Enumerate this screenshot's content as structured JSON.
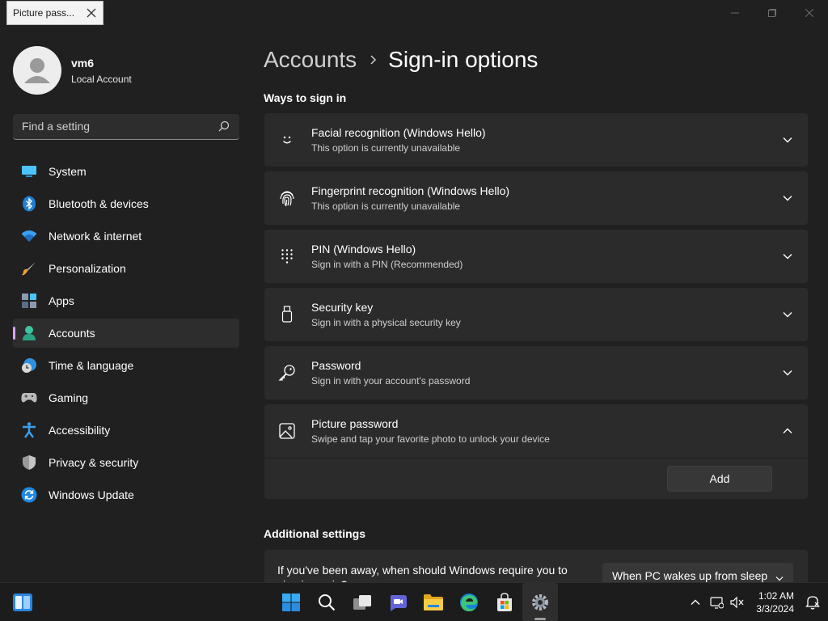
{
  "tooltip": {
    "label": "Picture pass..."
  },
  "profile": {
    "name": "vm6",
    "account_type": "Local Account"
  },
  "search": {
    "placeholder": "Find a setting"
  },
  "sidebar": {
    "items": [
      {
        "label": "System",
        "icon": "system-icon"
      },
      {
        "label": "Bluetooth & devices",
        "icon": "bluetooth-icon"
      },
      {
        "label": "Network & internet",
        "icon": "wifi-icon"
      },
      {
        "label": "Personalization",
        "icon": "brush-icon"
      },
      {
        "label": "Apps",
        "icon": "apps-icon"
      },
      {
        "label": "Accounts",
        "icon": "accounts-icon",
        "active": true
      },
      {
        "label": "Time & language",
        "icon": "globe-clock-icon"
      },
      {
        "label": "Gaming",
        "icon": "gamepad-icon"
      },
      {
        "label": "Accessibility",
        "icon": "accessibility-icon"
      },
      {
        "label": "Privacy & security",
        "icon": "shield-icon"
      },
      {
        "label": "Windows Update",
        "icon": "update-icon"
      }
    ]
  },
  "breadcrumb": {
    "parent": "Accounts",
    "current": "Sign-in options"
  },
  "ways_section": {
    "heading": "Ways to sign in",
    "options": [
      {
        "title": "Facial recognition (Windows Hello)",
        "subtitle": "This option is currently unavailable",
        "icon": "face-icon"
      },
      {
        "title": "Fingerprint recognition (Windows Hello)",
        "subtitle": "This option is currently unavailable",
        "icon": "fingerprint-icon"
      },
      {
        "title": "PIN (Windows Hello)",
        "subtitle": "Sign in with a PIN (Recommended)",
        "icon": "pin-keypad-icon"
      },
      {
        "title": "Security key",
        "subtitle": "Sign in with a physical security key",
        "icon": "usb-key-icon"
      },
      {
        "title": "Password",
        "subtitle": "Sign in with your account's password",
        "icon": "key-icon"
      },
      {
        "title": "Picture password",
        "subtitle": "Swipe and tap your favorite photo to unlock your device",
        "icon": "picture-icon",
        "expanded": true
      }
    ],
    "add_button": "Add"
  },
  "additional_section": {
    "heading": "Additional settings",
    "require_signin_question": "If you've been away, when should Windows require you to sign in again?",
    "require_signin_value": "When PC wakes up from sleep"
  },
  "taskbar": {
    "time": "1:02 AM",
    "date": "3/3/2024",
    "apps": [
      "start-icon",
      "search-icon",
      "task-view-icon",
      "teams-chat-icon",
      "file-explorer-icon",
      "edge-icon",
      "store-icon",
      "settings-icon"
    ]
  },
  "colors": {
    "background": "#202020",
    "card": "#2b2b2b",
    "accent": "#d7a5ef"
  }
}
